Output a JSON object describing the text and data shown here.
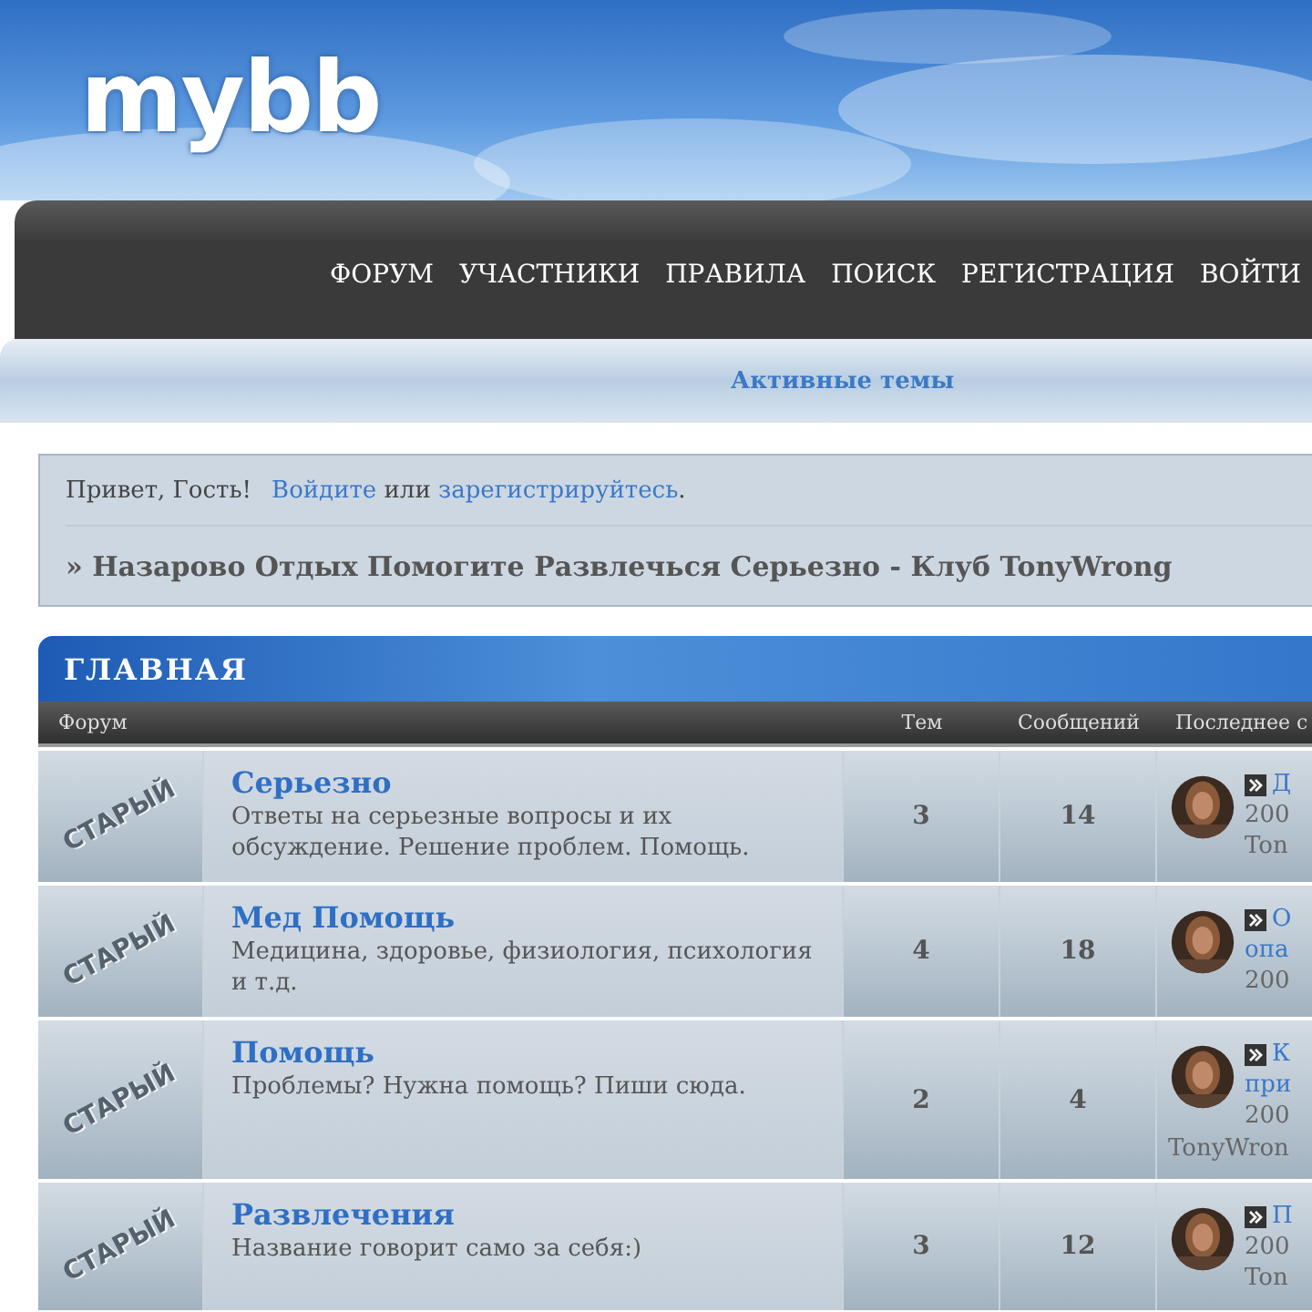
{
  "logo": "mybb",
  "nav": [
    "ФОРУМ",
    "УЧАСТНИКИ",
    "ПРАВИЛА",
    "ПОИСК",
    "РЕГИСТРАЦИЯ",
    "ВОЙТИ"
  ],
  "subnav": "Активные темы",
  "welcome": {
    "greeting": "Привет, Гость!",
    "login_link": "Войдите",
    "or": "или",
    "register_link": "зарегистрируйтесь",
    "end": "."
  },
  "breadcrumb": "» Назарово Отдых Помогите Развлечься Серьезно - Клуб TonyWrong",
  "category": {
    "title": "ГЛАВНАЯ",
    "columns": [
      "Форум",
      "Тем",
      "Сообщений",
      "Последнее с"
    ],
    "forums": [
      {
        "status": "СТАРЫЙ",
        "name": "Серьезно",
        "description": "Ответы на серьезные вопросы и их обсуждение. Решение проблем. Помощь.",
        "topics": "3",
        "posts": "14",
        "last_post": {
          "link_lines": [
            "Д"
          ],
          "date": "200",
          "author": "Ton"
        }
      },
      {
        "status": "СТАРЫЙ",
        "name": "Мед Помощь",
        "description": "Медицина, здоровье, физиология, психология и т.д.",
        "topics": "4",
        "posts": "18",
        "last_post": {
          "link_lines": [
            "О",
            "опа"
          ],
          "date": "200"
        }
      },
      {
        "status": "СТАРЫЙ",
        "name": "Помощь",
        "description": "Проблемы? Нужна помощь? Пиши сюда.",
        "topics": "2",
        "posts": "4",
        "last_post": {
          "link_lines": [
            "К",
            "при"
          ],
          "date": "200",
          "author": "TonyWron",
          "author_wrapped": true
        }
      },
      {
        "status": "СТАРЫЙ",
        "name": "Развлечения",
        "description": "Название говорит само за себя:)",
        "topics": "3",
        "posts": "12",
        "last_post": {
          "link_lines": [
            "П"
          ],
          "date": "200",
          "author": "Ton"
        }
      }
    ]
  }
}
